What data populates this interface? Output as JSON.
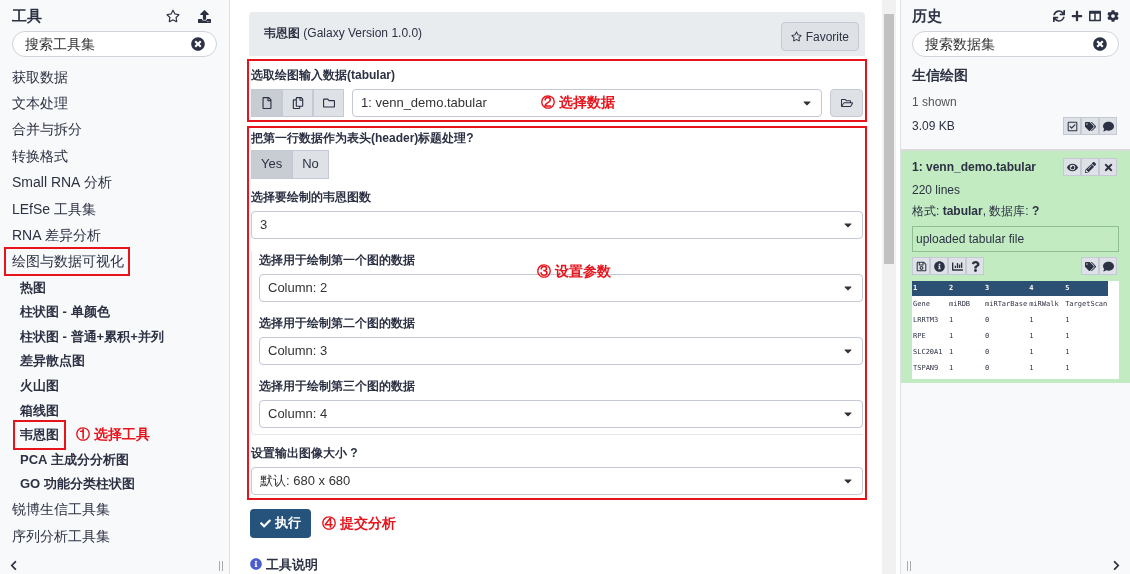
{
  "tool_panel": {
    "title": "工具",
    "search": {
      "placeholder": "搜索工具集"
    },
    "categories": [
      {
        "label": "获取数据",
        "highlighted": false
      },
      {
        "label": "文本处理",
        "highlighted": false
      },
      {
        "label": "合并与拆分",
        "highlighted": false
      },
      {
        "label": "转换格式",
        "highlighted": false
      },
      {
        "label": "Small RNA 分析",
        "highlighted": false
      },
      {
        "label": "LEfSe 工具集",
        "highlighted": false
      },
      {
        "label": "RNA 差异分析",
        "highlighted": false
      },
      {
        "label": "绘图与数据可视化",
        "highlighted": true,
        "children": [
          {
            "label": "热图",
            "highlighted": false
          },
          {
            "label": "柱状图 - 单颜色",
            "highlighted": false
          },
          {
            "label": "柱状图 - 普通+累积+并列",
            "highlighted": false
          },
          {
            "label": "差异散点图",
            "highlighted": false
          },
          {
            "label": "火山图",
            "highlighted": false
          },
          {
            "label": "箱线图",
            "highlighted": false
          },
          {
            "label": "韦恩图",
            "highlighted": true,
            "annotation": "① 选择工具"
          },
          {
            "label": "PCA 主成分分析图",
            "highlighted": false
          },
          {
            "label": "GO 功能分类柱状图",
            "highlighted": false
          }
        ]
      },
      {
        "label": "锐博生信工具集",
        "highlighted": false
      },
      {
        "label": "序列分析工具集",
        "highlighted": false
      }
    ]
  },
  "tool_form": {
    "name": "韦恩图",
    "version": "(Galaxy Version 1.0.0)",
    "favorite": "Favorite",
    "input": {
      "label": "选取绘图输入数据(tabular)",
      "source_modes": [
        {
          "kind": "file",
          "selected": true
        },
        {
          "kind": "files",
          "selected": false
        },
        {
          "kind": "folder",
          "selected": false
        }
      ],
      "value": "1: venn_demo.tabular",
      "annotation": "② 选择数据"
    },
    "params": {
      "annotation": "③ 设置参数",
      "header": {
        "label": "把第一行数据作为表头(header)标题处理?",
        "options": [
          {
            "label": "Yes",
            "selected": true
          },
          {
            "label": "No",
            "selected": false
          }
        ]
      },
      "count": {
        "label": "选择要绘制的韦恩图数",
        "value": "3"
      },
      "columns": [
        {
          "label": "选择用于绘制第一个图的数据",
          "value": "Column: 2"
        },
        {
          "label": "选择用于绘制第二个图的数据",
          "value": "Column: 3"
        },
        {
          "label": "选择用于绘制第三个图的数据",
          "value": "Column: 4"
        }
      ],
      "size": {
        "label": "设置输出图像大小 ?",
        "value": "默认: 680 x 680"
      }
    },
    "submit": {
      "label": "执行",
      "annotation": "④ 提交分析"
    },
    "help": "工具说明"
  },
  "history": {
    "title": "历史",
    "search": {
      "placeholder": "搜索数据集"
    },
    "name": "生信绘图",
    "shown": "1 shown",
    "size": "3.09 KB",
    "dataset": {
      "title": "1: venn_demo.tabular",
      "lines": "220 lines",
      "format": "格式: **tabular**, 数据库: **?**",
      "info": "uploaded tabular file",
      "peek": {
        "columns": [
          "1",
          "2",
          "3",
          "4",
          "5"
        ],
        "rows": [
          [
            "Gene",
            "miRDB",
            "miRTarBase",
            "miRWalk",
            "TargetScan"
          ],
          [
            "LRRTM3",
            "1",
            "0",
            "1",
            "1"
          ],
          [
            "RPE",
            "1",
            "0",
            "1",
            "1"
          ],
          [
            "SLC20A1",
            "1",
            "0",
            "1",
            "1"
          ],
          [
            "TSPAN9",
            "1",
            "0",
            "1",
            "1"
          ]
        ]
      }
    }
  }
}
